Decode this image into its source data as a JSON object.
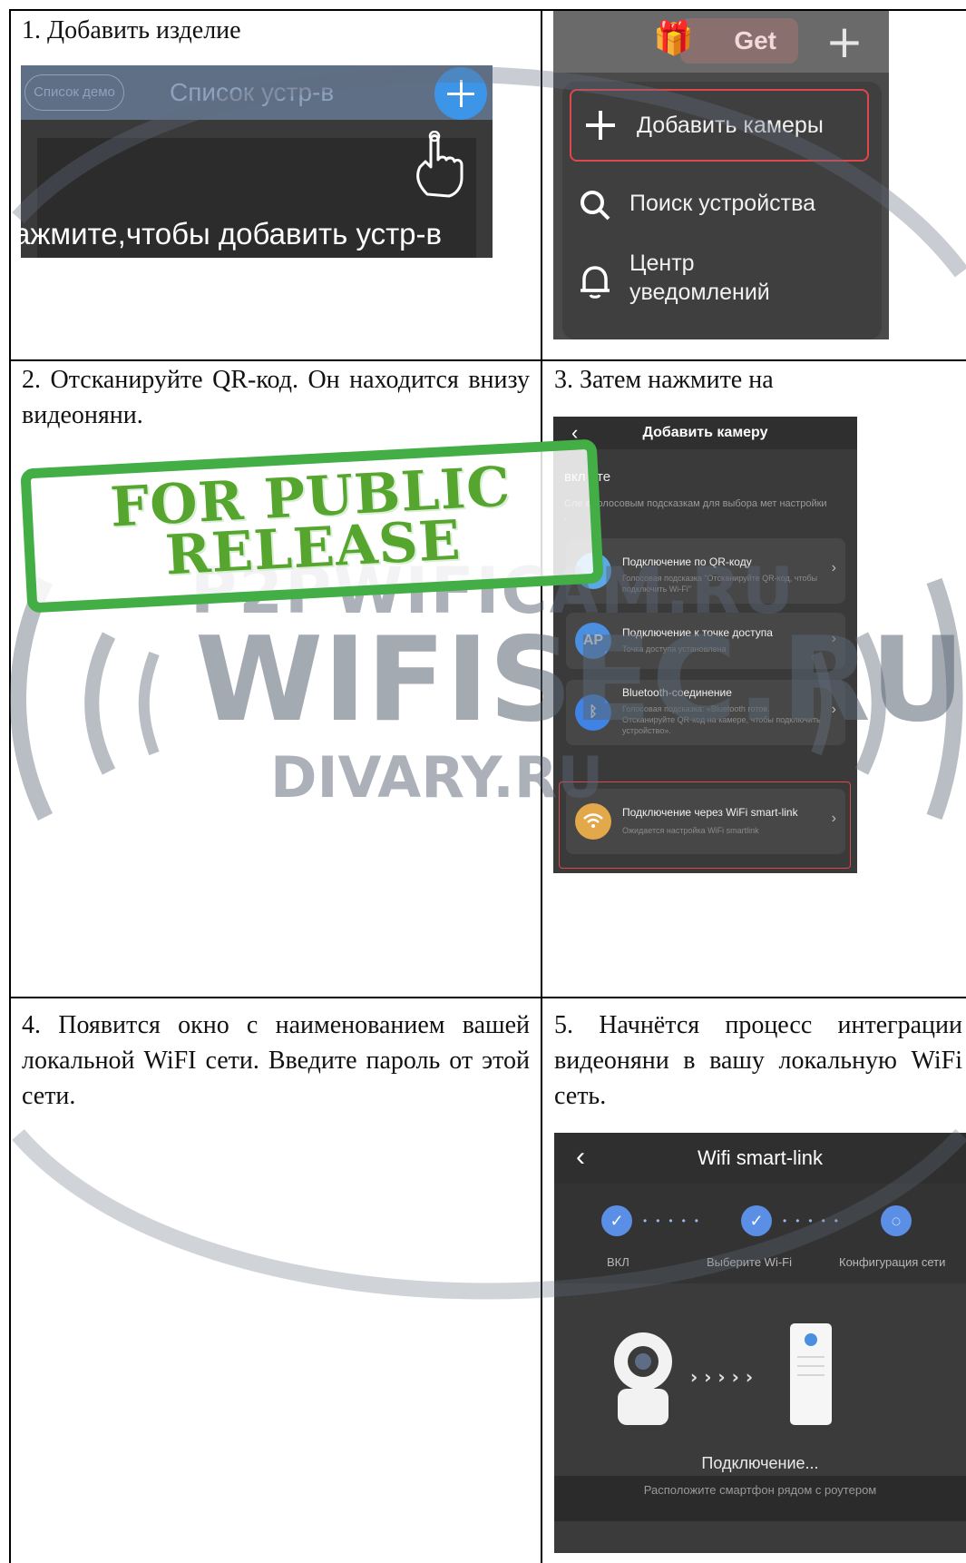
{
  "cells": {
    "step1": "1. Добавить изделие",
    "step2": "2. Отсканируйте QR-код. Он находится внизу видеоняни.",
    "step3": "3. Затем нажмите на",
    "step4": "4. Появится окно с наименованием вашей локальной WiFI сети. Введите пароль от этой сети.",
    "step5": "5. Начнётся процесс интеграции видеоняни в вашу локальную WiFi сеть."
  },
  "screen1": {
    "demo_button": "Список демо",
    "title": "Список устр-в",
    "hint": "ажмите,чтобы добавить устр-в"
  },
  "screen2": {
    "badge": "Get",
    "add_camera": "Добавить камеры",
    "search_device": "Поиск устройства",
    "notification_center": "Центр уведомлений"
  },
  "screen3": {
    "title": "Добавить камеру",
    "heading": "вкл   ите",
    "subtitle": "Сле    е голосовым подсказкам для выбора мет    настройки .",
    "options": [
      {
        "icon": "qr",
        "title": "Подключение по QR-коду",
        "desc": "Голосовая подсказка \"Отсканируйте QR-код, чтобы подключить Wi-Fi\""
      },
      {
        "icon": "AP",
        "title": "Подключение к точке доступа",
        "desc": "Точка доступа установлена"
      },
      {
        "icon": "bluetooth",
        "title": "Bluetooth-соединение",
        "desc": "Голосовая подсказка: «Bluetooth готов. Отсканируйте QR-код на камере, чтобы подключить устройство»."
      },
      {
        "icon": "wifi",
        "title": "Подключение через WiFi smart-link",
        "desc": "Ожидается настройка WiFi smartlink"
      }
    ]
  },
  "screen5": {
    "title": "Wifi smart-link",
    "steps": [
      "ВКЛ",
      "Выберите Wi-Fi",
      "Конфигурация сети"
    ],
    "status": "Подключение...",
    "footer": "Расположите смартфон рядом с роутером"
  },
  "watermark": {
    "line1": "P2PWIFICAM.RU",
    "line2": "WIFISEC.RU",
    "line3": "DIVARY.RU"
  },
  "stamp": {
    "line1": "FOR PUBLIC",
    "line2": "RELEASE"
  },
  "colors": {
    "stamp_green": "#43ad46",
    "accent_blue": "#3d95e8",
    "highlight_red": "#e0474c"
  }
}
